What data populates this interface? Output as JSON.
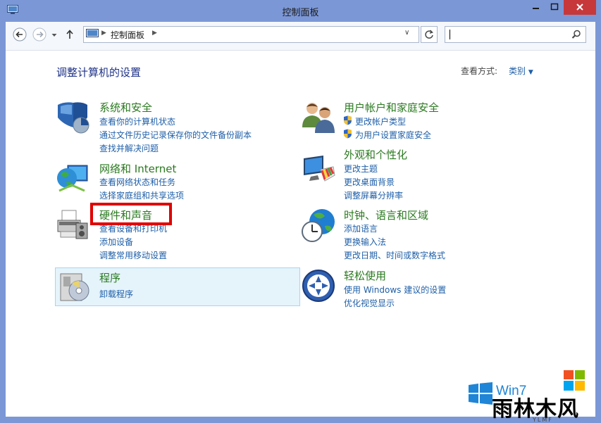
{
  "window": {
    "title": "控制面板"
  },
  "nav": {
    "breadcrumb": "控制面板",
    "search_value": ""
  },
  "main": {
    "heading": "调整计算机的设置",
    "view_by_label": "查看方式:",
    "view_by_value": "类别"
  },
  "categories": [
    {
      "title": "系统和安全",
      "icon": "system-security-shield-icon",
      "links": [
        "查看你的计算机状态",
        "通过文件历史记录保存你的文件备份副本",
        "查找并解决问题"
      ]
    },
    {
      "title": "网络和 Internet",
      "icon": "network-globe-icon",
      "links": [
        "查看网络状态和任务",
        "选择家庭组和共享选项"
      ]
    },
    {
      "title": "硬件和声音",
      "icon": "printer-icon",
      "links": [
        "查看设备和打印机",
        "添加设备",
        "调整常用移动设置"
      ]
    },
    {
      "title": "程序",
      "icon": "programs-disc-icon",
      "links": [
        "卸载程序"
      ]
    },
    {
      "title": "用户帐户和家庭安全",
      "icon": "users-icon",
      "links": [
        "更改帐户类型",
        "为用户设置家庭安全"
      ]
    },
    {
      "title": "外观和个性化",
      "icon": "monitor-palette-icon",
      "links": [
        "更改主题",
        "更改桌面背景",
        "调整屏幕分辨率"
      ]
    },
    {
      "title": "时钟、语言和区域",
      "icon": "clock-globe-icon",
      "links": [
        "添加语言",
        "更换输入法",
        "更改日期、时间或数字格式"
      ]
    },
    {
      "title": "轻松使用",
      "icon": "ease-of-access-icon",
      "links": [
        "使用 Windows 建议的设置",
        "优化视觉显示"
      ]
    }
  ],
  "watermark": {
    "partial_text": "Win7",
    "brand": "雨林木风",
    "sub": "YLMF"
  },
  "colors": {
    "title_bar": "#7b97d6",
    "close_button": "#c7383a",
    "category_title": "#2a7a1f",
    "link": "#1e5fa8",
    "heading": "#1e3287",
    "highlight_box": "#e00000"
  }
}
